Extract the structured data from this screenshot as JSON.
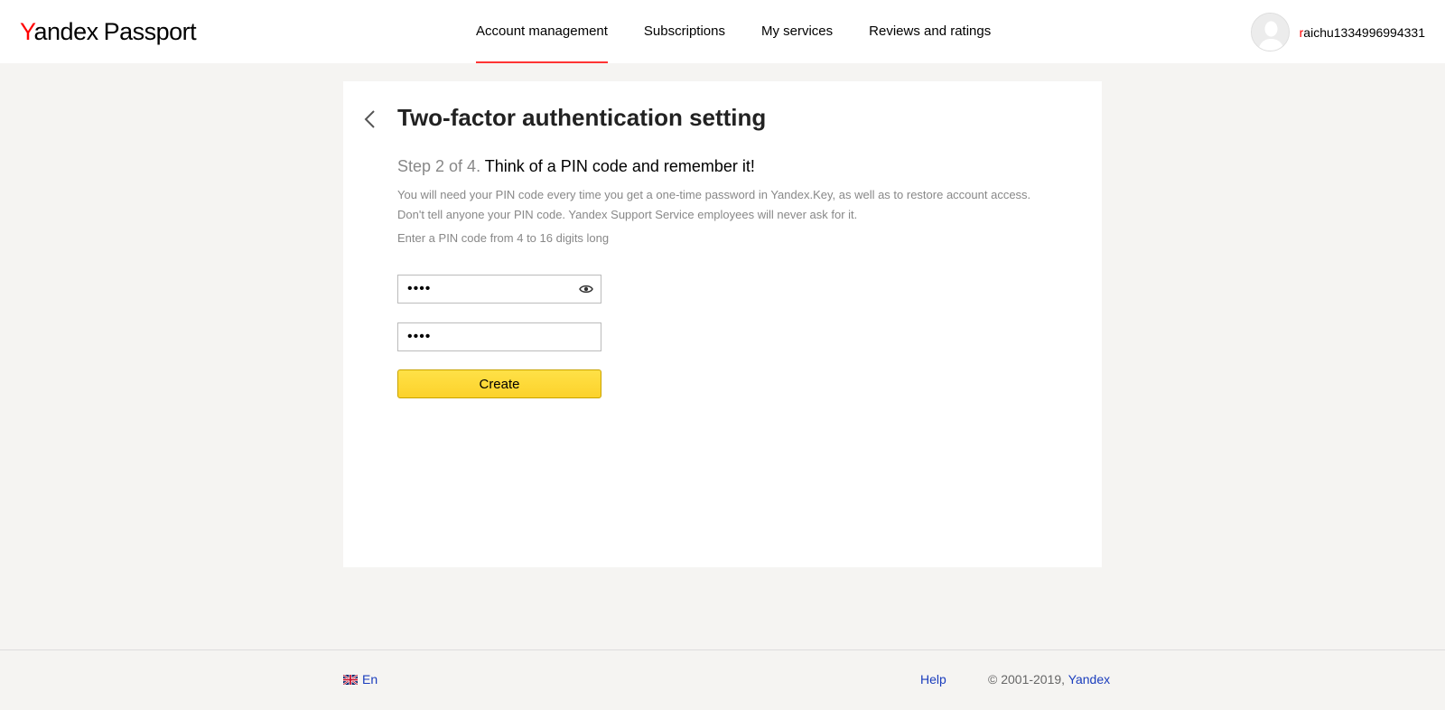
{
  "header": {
    "logo": {
      "y_letter": "Y",
      "brand_rest": "andex",
      "product": "Passport"
    },
    "nav": [
      {
        "label": "Account management",
        "active": true
      },
      {
        "label": "Subscriptions"
      },
      {
        "label": "My services"
      },
      {
        "label": "Reviews and ratings"
      }
    ],
    "user": {
      "first_letter": "r",
      "rest": "aichu1334996994331"
    }
  },
  "main": {
    "title": "Two-factor authentication setting",
    "step_number": "Step 2 of 4.",
    "step_text": "Think of a PIN code and remember it!",
    "description_line1": "You will need your PIN code every time you get a one-time password in Yandex.Key, as well as to restore account access.",
    "description_line2": "Don't tell anyone your PIN code. Yandex Support Service employees will never ask for it.",
    "hint": "Enter a PIN code from 4 to 16 digits long",
    "pin_value": "••••",
    "pin_confirm_value": "••••",
    "create_label": "Create"
  },
  "footer": {
    "language": "En",
    "help": "Help",
    "copyright": "© 2001-2019, ",
    "company": "Yandex"
  },
  "colors": {
    "accent_red": "#ff3333",
    "button_yellow": "#ffdb4d",
    "link_blue": "#1a3dbd"
  }
}
